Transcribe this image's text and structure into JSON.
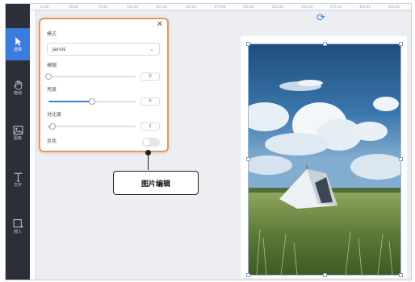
{
  "toolbar": {
    "items": [
      {
        "label": "选择",
        "icon": "cursor-icon"
      },
      {
        "label": "拖动",
        "icon": "hand-icon"
      },
      {
        "label": "图像",
        "icon": "image-icon"
      },
      {
        "label": "文字",
        "icon": "text-icon"
      },
      {
        "label": "插入",
        "icon": "insert-icon"
      }
    ]
  },
  "ruler": {
    "top_ticks": [
      "25.00",
      "50.00",
      "75.00",
      "100.00",
      "125.00",
      "150.00",
      "175.00",
      "200.00",
      "225.00",
      "250.00",
      "275.00",
      "300.00",
      "325.00"
    ]
  },
  "panel": {
    "mode_label": "模式",
    "mode_value": "Jarvis",
    "blur_label": "模糊",
    "blur_value": "0",
    "blur_level": 0,
    "brightness_label": "亮度",
    "brightness_value": "0",
    "brightness_level": 0.5,
    "contrast_label": "对比度",
    "contrast_value": "1",
    "contrast_level": 0.05,
    "invert_label": "反色",
    "invert_on": false,
    "close_symbol": "✕"
  },
  "callout": {
    "text": "图片编辑"
  },
  "colors": {
    "accent": "#3b7ddd",
    "highlight_border": "#e8955a",
    "toolbar_bg": "#2b2f38"
  }
}
